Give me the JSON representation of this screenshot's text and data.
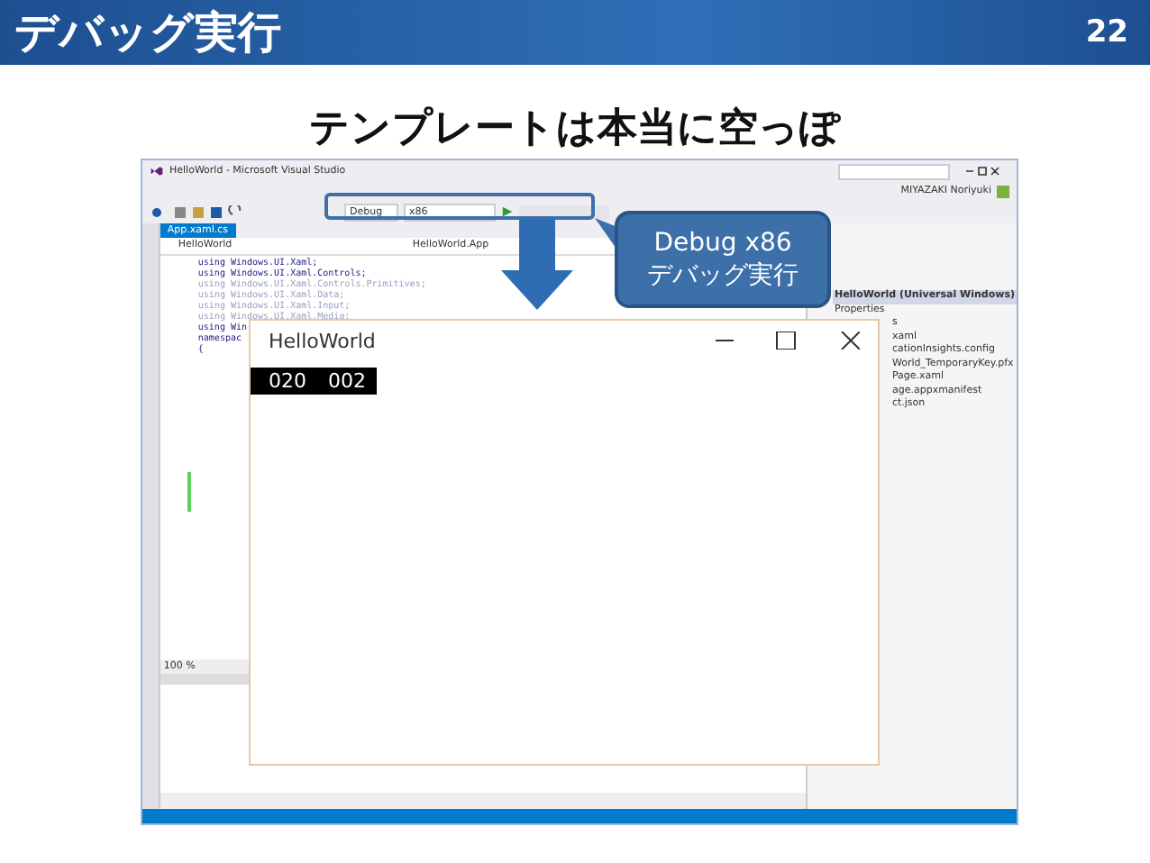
{
  "slide": {
    "title": "デバッグ実行",
    "page_number": "22",
    "subtitle": "テンプレートは本当に空っぽ"
  },
  "vs_window": {
    "title": "HelloWorld - Microsoft Visual Studio",
    "user": "MIYAZAKI Noriyuki",
    "toolbar": {
      "configuration": "Debug",
      "platform": "x86"
    },
    "editor": {
      "tab": "App.xaml.cs",
      "nav_left": "HelloWorld",
      "nav_right": "HelloWorld.App",
      "zoom": "100 %",
      "lines": [
        {
          "text": "using Windows.UI.Xaml;",
          "dim": false
        },
        {
          "text": "using Windows.UI.Xaml.Controls;",
          "dim": false
        },
        {
          "text": "using Windows.UI.Xaml.Controls.Primitives;",
          "dim": true
        },
        {
          "text": "using Windows.UI.Xaml.Data;",
          "dim": true
        },
        {
          "text": "using Windows.UI.Xaml.Input;",
          "dim": true
        },
        {
          "text": "using Windows.UI.Xaml.Media;",
          "dim": true
        },
        {
          "text": "using Win",
          "dim": false
        },
        {
          "text": "namespac",
          "dim": false
        },
        {
          "text": "{",
          "dim": false
        }
      ]
    },
    "solution_explorer": {
      "items": [
        {
          "label": "HelloWorld (Universal Windows)",
          "selected": true
        },
        {
          "label": "Properties",
          "selected": false
        }
      ],
      "files": [
        {
          "label": "s",
          "selected": false
        },
        {
          "label": "xaml",
          "selected": false
        },
        {
          "label": "cationInsights.config",
          "selected": false
        },
        {
          "label": "World_TemporaryKey.pfx",
          "selected": false
        },
        {
          "label": "Page.xaml",
          "selected": false
        },
        {
          "label": "age.appxmanifest",
          "selected": false
        },
        {
          "label": "ct.json",
          "selected": false
        }
      ]
    }
  },
  "app_window": {
    "title": "HelloWorld",
    "counters": [
      "020",
      "002"
    ]
  },
  "callout": {
    "lines": [
      "Debug x86",
      "デバッグ実行"
    ]
  }
}
